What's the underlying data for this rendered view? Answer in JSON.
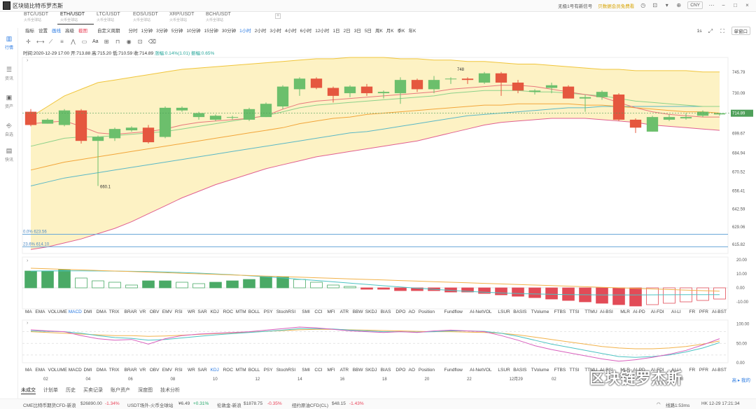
{
  "title_bar": {
    "app_name": "区块链比特币罗杰斯",
    "news": "无极1号有新信号",
    "notice": "贝数据会员免费看",
    "currency": "CNY"
  },
  "symbol_tabs": [
    {
      "name": "BTC/USDT",
      "sub": "火币全球站"
    },
    {
      "name": "ETH/USDT",
      "sub": "火币全球站"
    },
    {
      "name": "LTC/USDT",
      "sub": "火币全球站"
    },
    {
      "name": "EOS/USDT",
      "sub": "火币全球站"
    },
    {
      "name": "XRP/USDT",
      "sub": "火币全球站"
    },
    {
      "name": "BCH/USDT",
      "sub": "火币全球站"
    }
  ],
  "sidebar": [
    {
      "label": "行情",
      "icon": "chart-icon"
    },
    {
      "label": "资讯",
      "icon": "news-icon"
    },
    {
      "label": "资产",
      "icon": "wallet-icon"
    },
    {
      "label": "自选",
      "icon": "star-icon"
    },
    {
      "label": "快讯",
      "icon": "flash-icon"
    }
  ],
  "toolbar": {
    "indicators": "指标",
    "settings": "设置",
    "drawing": "画线",
    "advanced": "高级",
    "screenshot": "截图",
    "custom_period": "自定义周期",
    "periods": [
      "分时",
      "1分钟",
      "3分钟",
      "5分钟",
      "10分钟",
      "15分钟",
      "30分钟",
      "1小时",
      "2小时",
      "3小时",
      "4小时",
      "6小时",
      "12小时",
      "1日",
      "2日",
      "3日",
      "5日",
      "周K",
      "月K",
      "季K",
      "年K"
    ],
    "selected_period": "1小时",
    "window_mode": "单窗口",
    "refresh": "1s",
    "text_tool": "Aa"
  },
  "info": {
    "time": "时间:2020-12-29 17:00",
    "open": "开:713.88",
    "high": "高:715.20",
    "low": "低:710.59",
    "close": "收:714.89",
    "change": "涨幅:0.14%(1.01)",
    "amplitude": "振幅:0.65%"
  },
  "price_axis": [
    "745.79",
    "730.09",
    "714.89",
    "699.67",
    "684.94",
    "670.52",
    "656.41",
    "642.59",
    "629.06",
    "615.82"
  ],
  "current_price": "714.89",
  "annotations": {
    "high_label": "748",
    "low_label": "660.1",
    "fib0": "0.0% 623.56",
    "fib236": "23.6% 614.10"
  },
  "macd_axis": [
    "20.00",
    "10.00",
    "0.00",
    "-10.00"
  ],
  "kdj_axis": [
    "100.00",
    "50.00",
    "0.00"
  ],
  "indicators": [
    "MA",
    "EMA",
    "VOLUME",
    "MACD",
    "DMI",
    "DMA",
    "TRIX",
    "BRAR",
    "VR",
    "OBV",
    "EMV",
    "RSI",
    "WR",
    "SAR",
    "KDJ",
    "ROC",
    "MTM",
    "BOLL",
    "PSY",
    "StochRSI",
    "SMI",
    "CCI",
    "MFI",
    "ATR",
    "BBW",
    "SKDJ",
    "BIAS",
    "DPO",
    "AO",
    "Position",
    "Fundflow",
    "AI-NetVOL",
    "LSUR",
    "BASIS",
    "TVolume",
    "FTBS",
    "TTSI",
    "TTMU",
    "AI-BSI",
    "MLR",
    "AI-PD",
    "AI-FDI",
    "AI-LI",
    "FR",
    "PFR",
    "AI-BST"
  ],
  "indicator_selected_row1": "MACD",
  "indicator_selected_row2": "KDJ",
  "time_axis": [
    "02",
    "04",
    "06",
    "08",
    "10",
    "12",
    "14",
    "16",
    "18",
    "20",
    "22",
    "12月29",
    "02",
    "04",
    "06",
    "08"
  ],
  "bottom_tabs": [
    "未成交",
    "计划单",
    "历史",
    "买卖记录",
    "账户资产",
    "深度图",
    "技术分析"
  ],
  "bottom_right": "高 ▸ 我的",
  "status": {
    "cme": "CME比特币期货CFD-新浪",
    "cme_price": "$26890.00",
    "cme_pct": "-1.34%",
    "usdt": "USDT场外-火币全球站",
    "usdt_price": "¥6.49",
    "usdt_pct": "+0.31%",
    "gold": "伦敦金-新浪",
    "gold_price": "$1878.75",
    "gold_pct": "-0.35%",
    "oil": "纽约原油CFD(CL)",
    "oil_price": "$48.15",
    "oil_pct": "-1.43%",
    "network": "线路1:53ms",
    "clock": "HK 12-29 17:21:34"
  },
  "watermark": "区块链罗杰斯",
  "chart_data": {
    "type": "candlestick",
    "y_range": [
      609,
      757
    ],
    "candles": [
      [
        716,
        706,
        718,
        705
      ],
      [
        707,
        710,
        711,
        707
      ],
      [
        706,
        717,
        718,
        705
      ],
      [
        717,
        694,
        718,
        692
      ],
      [
        694,
        697,
        698,
        660
      ],
      [
        696,
        703,
        704,
        694
      ],
      [
        702,
        704,
        705,
        701
      ],
      [
        704,
        693,
        706,
        692
      ],
      [
        697,
        719,
        720,
        696
      ],
      [
        717,
        719,
        720,
        716
      ],
      [
        712,
        715,
        716,
        710
      ],
      [
        710,
        713,
        714,
        709
      ],
      [
        712,
        712,
        713,
        710
      ],
      [
        710,
        718,
        719,
        709
      ],
      [
        712,
        722,
        723,
        712
      ],
      [
        720,
        735,
        736,
        718
      ],
      [
        733,
        741,
        742,
        728
      ],
      [
        741,
        734,
        742,
        733
      ],
      [
        734,
        728,
        735,
        723
      ],
      [
        730,
        735,
        736,
        727
      ],
      [
        735,
        730,
        737,
        728
      ],
      [
        730,
        731,
        732,
        726
      ],
      [
        730,
        740,
        742,
        722
      ],
      [
        740,
        733,
        741,
        731
      ],
      [
        733,
        740,
        743,
        730
      ],
      [
        741,
        741,
        742,
        737
      ],
      [
        741,
        740,
        742,
        737
      ],
      [
        738,
        745,
        746,
        737
      ],
      [
        745,
        738,
        746,
        728
      ],
      [
        738,
        732,
        740,
        730
      ],
      [
        731,
        732,
        733,
        729
      ],
      [
        734,
        736,
        738,
        730
      ],
      [
        735,
        726,
        736,
        726
      ],
      [
        726,
        727,
        729,
        716
      ],
      [
        727,
        731,
        732,
        725
      ],
      [
        729,
        710,
        730,
        709
      ],
      [
        710,
        704,
        711,
        700
      ],
      [
        701,
        712,
        713,
        701
      ],
      [
        710,
        712,
        714,
        709
      ],
      [
        711,
        712,
        715,
        710
      ],
      [
        713,
        716,
        717,
        712
      ],
      [
        714,
        714.89,
        715,
        713
      ]
    ],
    "bollinger_upper": [
      712,
      720,
      728,
      733,
      738,
      740,
      742,
      744,
      746,
      748,
      749,
      750,
      751,
      752,
      753,
      754,
      755,
      756,
      756,
      757,
      757,
      757,
      756,
      756,
      755,
      755,
      754,
      754,
      753,
      752,
      752,
      751,
      750,
      749,
      748,
      748,
      747,
      747,
      747,
      747,
      746,
      746
    ],
    "bollinger_lower": [
      612,
      614,
      617,
      620,
      624,
      628,
      633,
      639,
      645,
      651,
      656,
      661,
      665,
      669,
      673,
      676,
      679,
      682,
      684,
      686,
      688,
      690,
      692,
      694,
      697,
      700,
      703,
      706,
      708,
      709,
      710,
      711,
      711,
      711,
      710,
      709,
      708,
      706,
      705,
      704,
      703,
      702
    ],
    "ma_red": [
      707,
      708,
      709,
      705,
      700,
      699,
      700,
      701,
      703,
      706,
      708,
      709,
      710,
      711,
      713,
      718,
      722,
      724,
      725,
      726,
      727,
      728,
      729,
      730,
      731,
      733,
      734,
      735,
      736,
      736,
      735,
      733,
      731,
      729,
      727,
      723,
      719,
      716,
      714,
      713,
      712,
      712
    ],
    "ma_green": [
      690,
      693,
      696,
      697,
      697,
      698,
      699,
      700,
      701,
      703,
      705,
      707,
      709,
      711,
      713,
      716,
      719,
      721,
      722,
      723,
      724,
      725,
      726,
      727,
      728,
      730,
      731,
      732,
      732,
      732,
      731,
      731,
      730,
      729,
      728,
      726,
      724,
      723,
      722,
      721,
      720,
      720
    ],
    "ma_orange": [
      672,
      675,
      678,
      680,
      682,
      684,
      686,
      688,
      690,
      692,
      694,
      696,
      698,
      700,
      702,
      704,
      707,
      709,
      711,
      712,
      714,
      715,
      716,
      717,
      718,
      719,
      720,
      721,
      721,
      722,
      722,
      722,
      722,
      721,
      721,
      720,
      719,
      718,
      717,
      716,
      716,
      715
    ],
    "ma_teal": [
      660,
      663,
      666,
      668,
      670,
      672,
      674,
      676,
      678,
      680,
      682,
      684,
      686,
      688,
      690,
      692,
      694,
      696,
      698,
      700,
      701,
      703,
      705,
      707,
      709,
      711,
      713,
      714,
      715,
      716,
      717,
      718,
      719,
      719,
      720,
      720,
      720,
      720,
      720,
      720,
      720,
      720
    ],
    "macd_hist": [
      12,
      12,
      13,
      7,
      5,
      4,
      2,
      5,
      5,
      4,
      3,
      4,
      5,
      6,
      8,
      8,
      6,
      4,
      2,
      1,
      -1,
      -1,
      -2,
      -2,
      -2,
      -3,
      -3,
      -4,
      -5,
      -6,
      -7,
      -8,
      -9,
      -10,
      -11,
      -12,
      -13,
      -12,
      -11,
      -10,
      -9,
      -8
    ],
    "kdj_k": [
      85,
      82,
      80,
      70,
      62,
      58,
      60,
      48,
      62,
      70,
      74,
      76,
      78,
      80,
      84,
      88,
      92,
      90,
      86,
      82,
      80,
      78,
      80,
      78,
      82,
      84,
      82,
      80,
      70,
      58,
      44,
      34,
      26,
      18,
      10,
      4,
      8,
      14,
      22,
      32,
      46,
      62
    ],
    "kdj_d": [
      82,
      81,
      80,
      76,
      70,
      65,
      63,
      58,
      60,
      64,
      68,
      72,
      75,
      78,
      81,
      84,
      88,
      88,
      87,
      84,
      82,
      80,
      80,
      79,
      80,
      82,
      82,
      81,
      76,
      68,
      58,
      48,
      40,
      32,
      24,
      16,
      14,
      16,
      20,
      28,
      38,
      52
    ],
    "kdj_j": [
      80,
      78,
      76,
      74,
      72,
      70,
      70,
      68,
      69,
      71,
      73,
      75,
      77,
      79,
      81,
      83,
      85,
      86,
      86,
      85,
      84,
      83,
      82,
      81,
      80,
      80,
      79,
      78,
      76,
      72,
      66,
      60,
      54,
      48,
      42,
      38,
      36,
      36,
      38,
      42,
      48,
      56
    ]
  }
}
